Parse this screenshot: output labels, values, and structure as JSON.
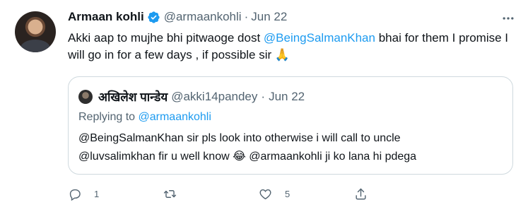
{
  "author": {
    "name": "Armaan kohli",
    "handle": "@armaankohli",
    "separator": "·",
    "date": "Jun 22"
  },
  "tweet": {
    "text_1": "Akki aap to mujhe bhi pitwaoge dost ",
    "mention_1": "@BeingSalmanKhan",
    "text_2": " bhai for them I promise I will go in for a few days , if possible sir ",
    "emoji": "🙏"
  },
  "quote": {
    "name": "अखिलेश पान्डेय",
    "handle": "@akki14pandey",
    "separator": "·",
    "date": "Jun 22",
    "replying_prefix": "Replying to ",
    "replying_handle": "@armaankohli",
    "line_1": "@BeingSalmanKhan  sir pls look into otherwise i will call to uncle",
    "line_2_a": "@luvsalimkhan fir u well know ",
    "line_2_emoji": "😂",
    "line_2_b": " @armaankohli  ji ko lana hi pdega"
  },
  "actions": {
    "reply_count": "1",
    "retweet_count": "",
    "like_count": "5"
  },
  "colors": {
    "accent": "#1d9bf0",
    "secondary_text": "#536471",
    "border": "#cfd9de"
  },
  "icons": [
    "verified-badge-icon",
    "more-icon",
    "reply-icon",
    "retweet-icon",
    "like-icon",
    "share-icon"
  ]
}
